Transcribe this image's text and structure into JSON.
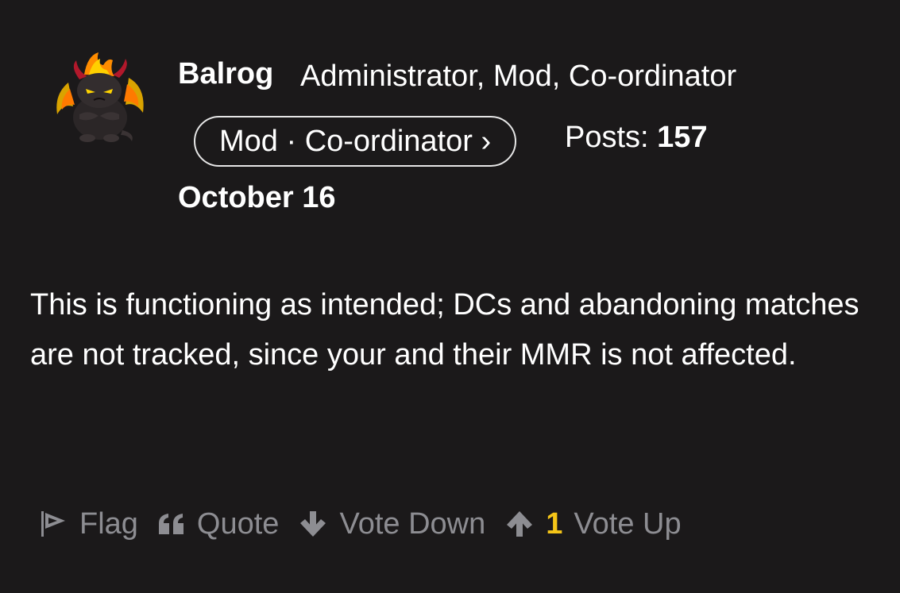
{
  "author": {
    "name": "Balrog",
    "roles": "Administrator, Mod, Co-ordinator",
    "avatar_icon": "balrog-demon-avatar",
    "role_pill": "Mod · Co-ordinator ›",
    "posts_label": "Posts:",
    "posts_count": "157"
  },
  "post": {
    "date": "October 16",
    "body": "This is functioning as intended; DCs and abandoning matches are not tracked, since your and their MMR is not affected."
  },
  "actions": {
    "flag": {
      "label": "Flag",
      "icon": "flag-icon"
    },
    "quote": {
      "label": "Quote",
      "icon": "quote-icon"
    },
    "vote_down": {
      "label": "Vote Down",
      "icon": "arrow-down-icon"
    },
    "vote_up": {
      "label": "Vote Up",
      "icon": "arrow-up-icon",
      "count": "1"
    }
  },
  "colors": {
    "background": "#1b191a",
    "text": "#ffffff",
    "muted": "#8d8d92",
    "vote_count": "#f5c518"
  }
}
